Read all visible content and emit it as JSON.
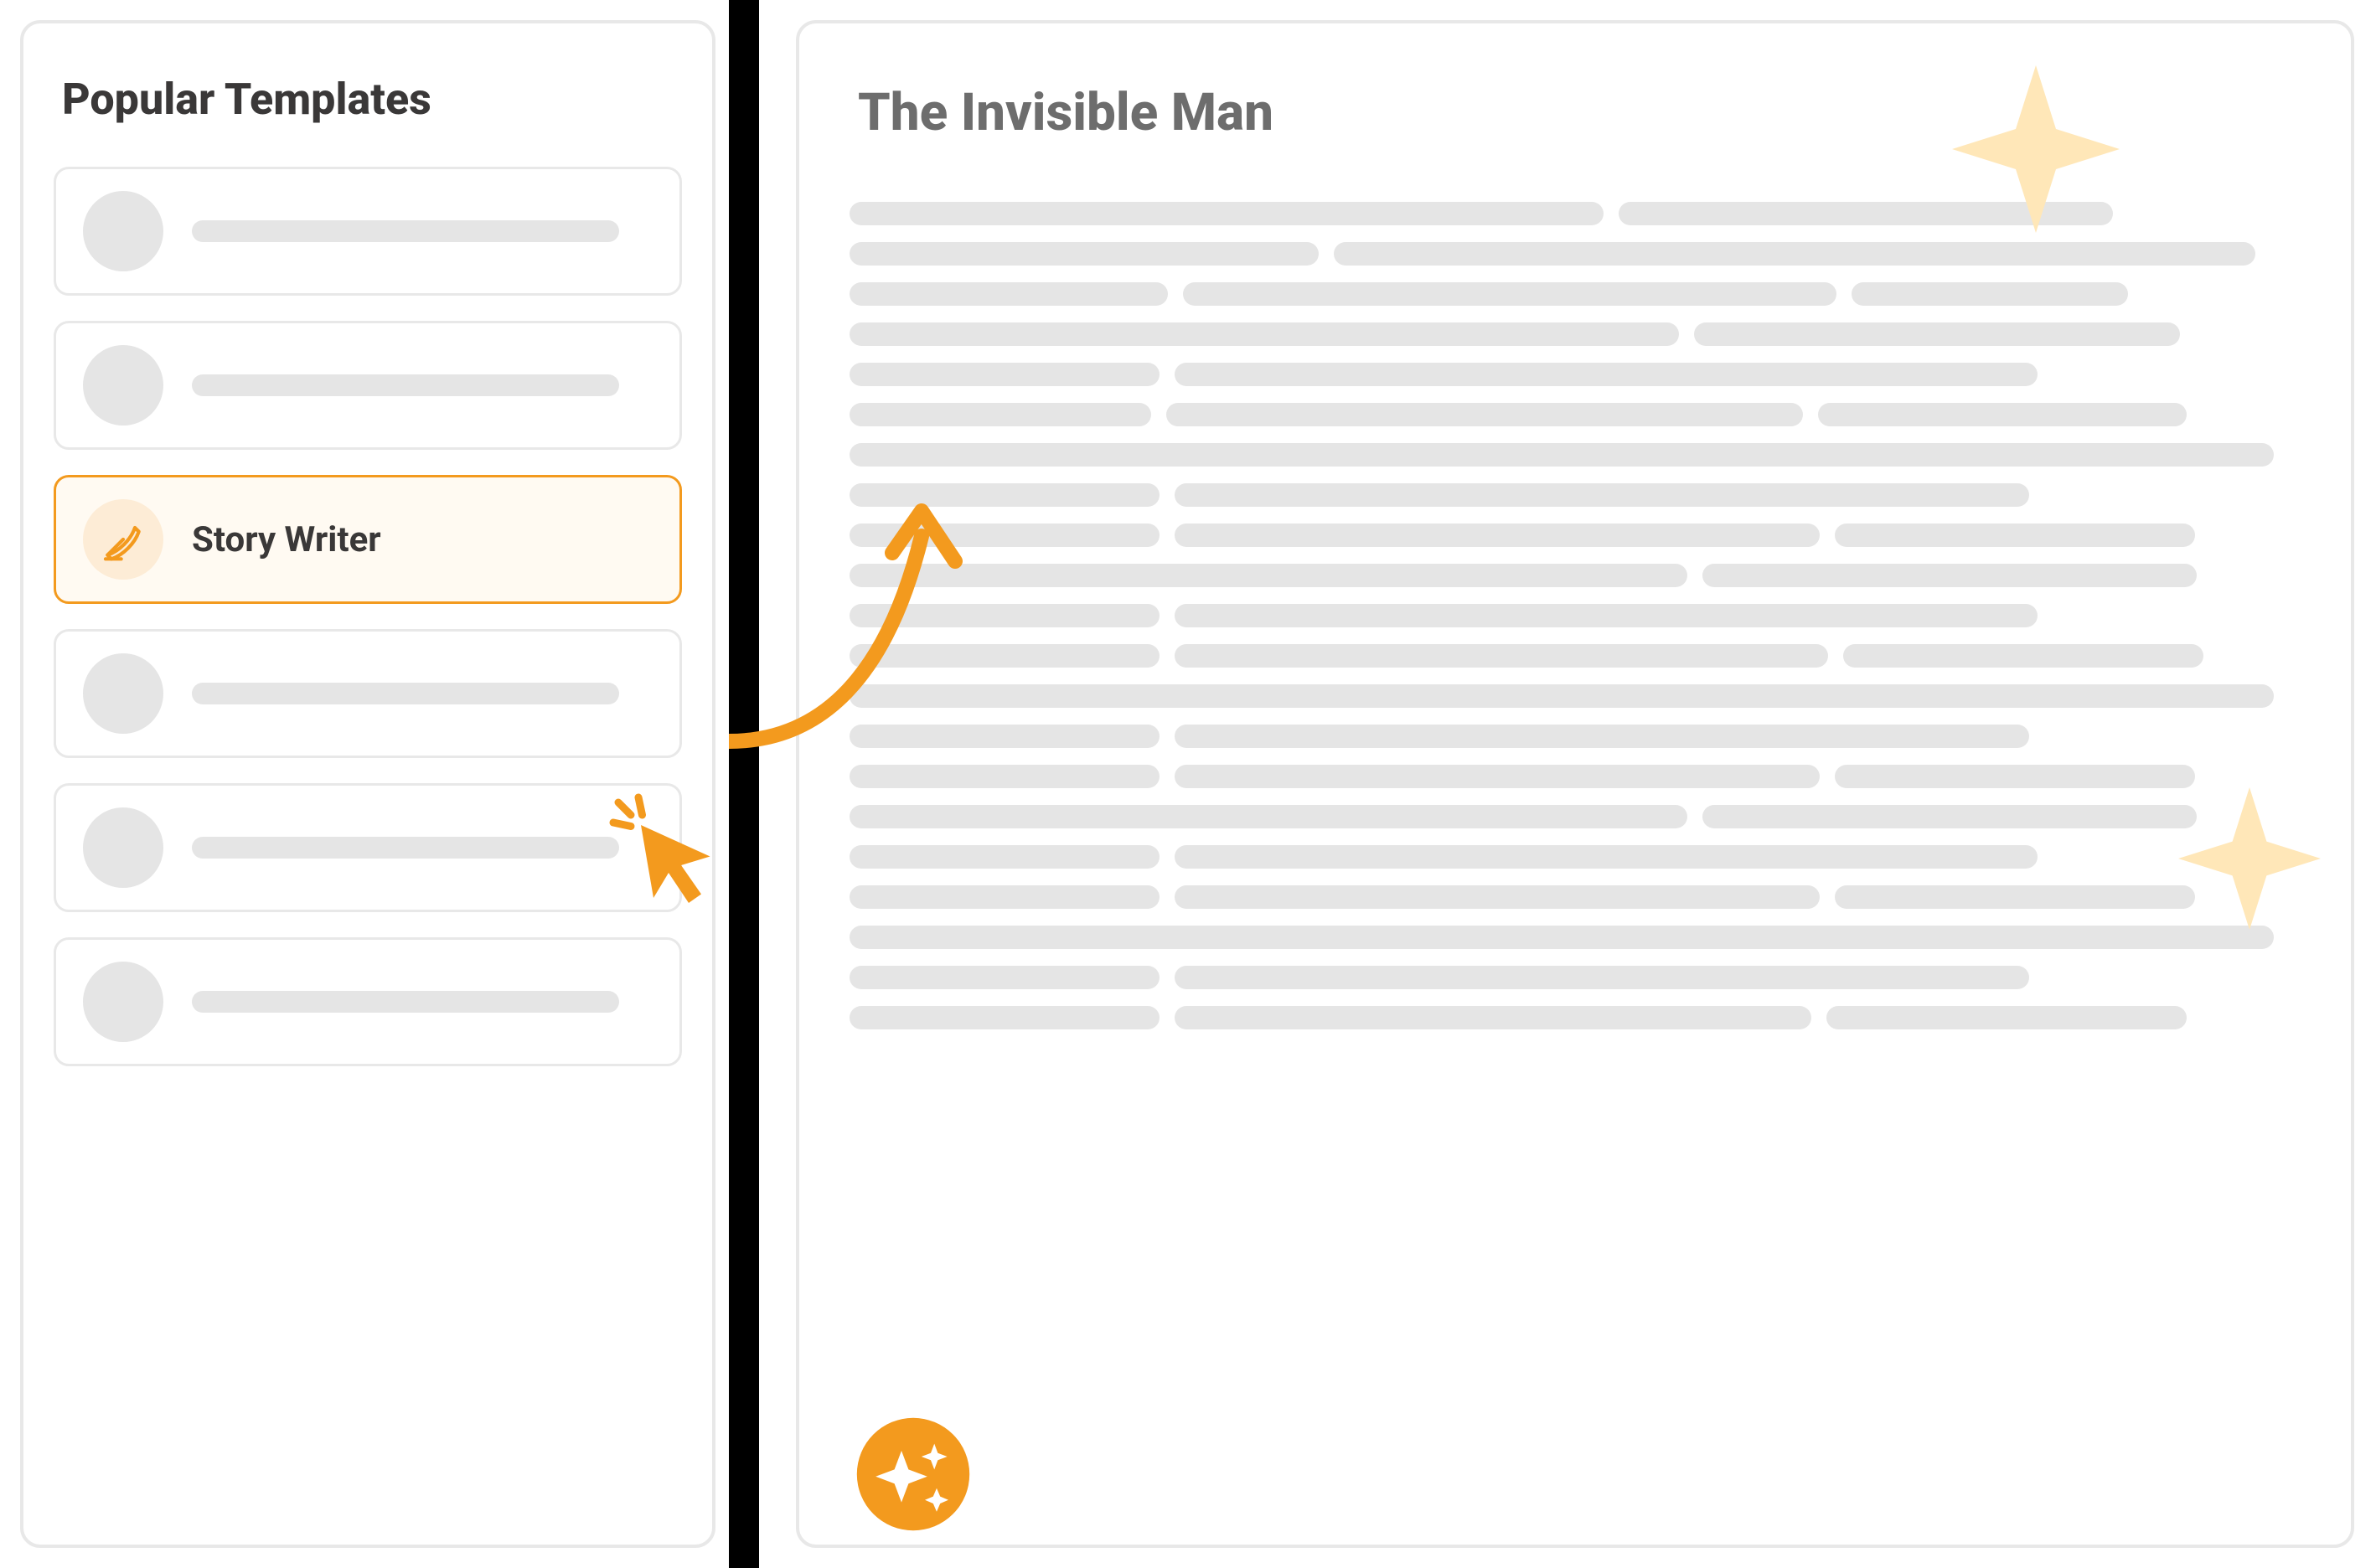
{
  "sidebar": {
    "title": "Popular Templates",
    "selected": {
      "label": "Story Writer",
      "icon": "quill-icon"
    }
  },
  "document": {
    "title": "The Invisible Man"
  },
  "colors": {
    "accent": "#f39a1e",
    "accent_light": "#fdecd6",
    "placeholder": "#e5e5e5",
    "text": "#3a3838",
    "text_muted": "#6d6d6d",
    "border": "#e8e8e8",
    "star_pale": "#ffe7b8",
    "divider": "#000000"
  },
  "decor": {
    "cursor": "cursor-click-icon",
    "arrow": "curved-arrow-icon",
    "sparkle": "sparkle-badge-icon",
    "star1": "star-icon",
    "star2": "star-icon"
  }
}
